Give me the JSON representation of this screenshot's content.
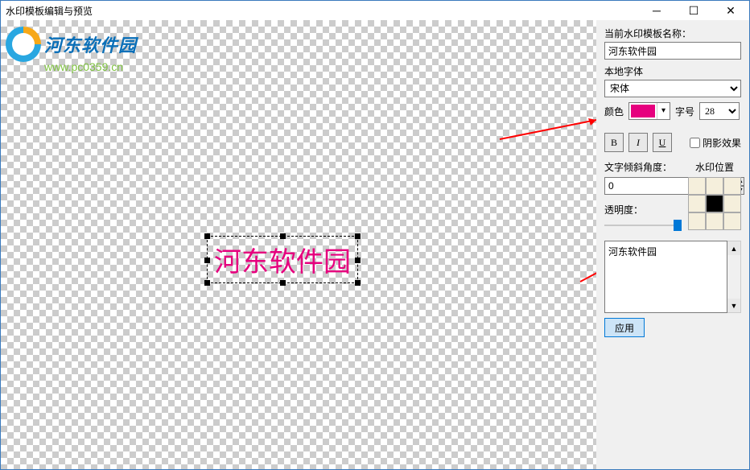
{
  "window": {
    "title": "水印模板编辑与预览"
  },
  "logo": {
    "text": "河东软件园",
    "url": "www.pc0359.cn"
  },
  "canvas": {
    "watermark_text": "河东软件园"
  },
  "panel": {
    "template_name_label": "当前水印模板名称：",
    "template_name_value": "河东软件园",
    "font_label": "本地字体",
    "font_value": "宋体",
    "color_label": "颜色",
    "color_value": "#e6007e",
    "size_label": "字号",
    "size_value": "28",
    "bold": "B",
    "italic": "I",
    "underline": "U",
    "shadow_label": "阴影效果",
    "tilt_label": "文字倾斜角度：",
    "tilt_value": "0",
    "opacity_label": "透明度：",
    "position_label": "水印位置",
    "text_value": "河东软件园",
    "apply_label": "应用"
  }
}
